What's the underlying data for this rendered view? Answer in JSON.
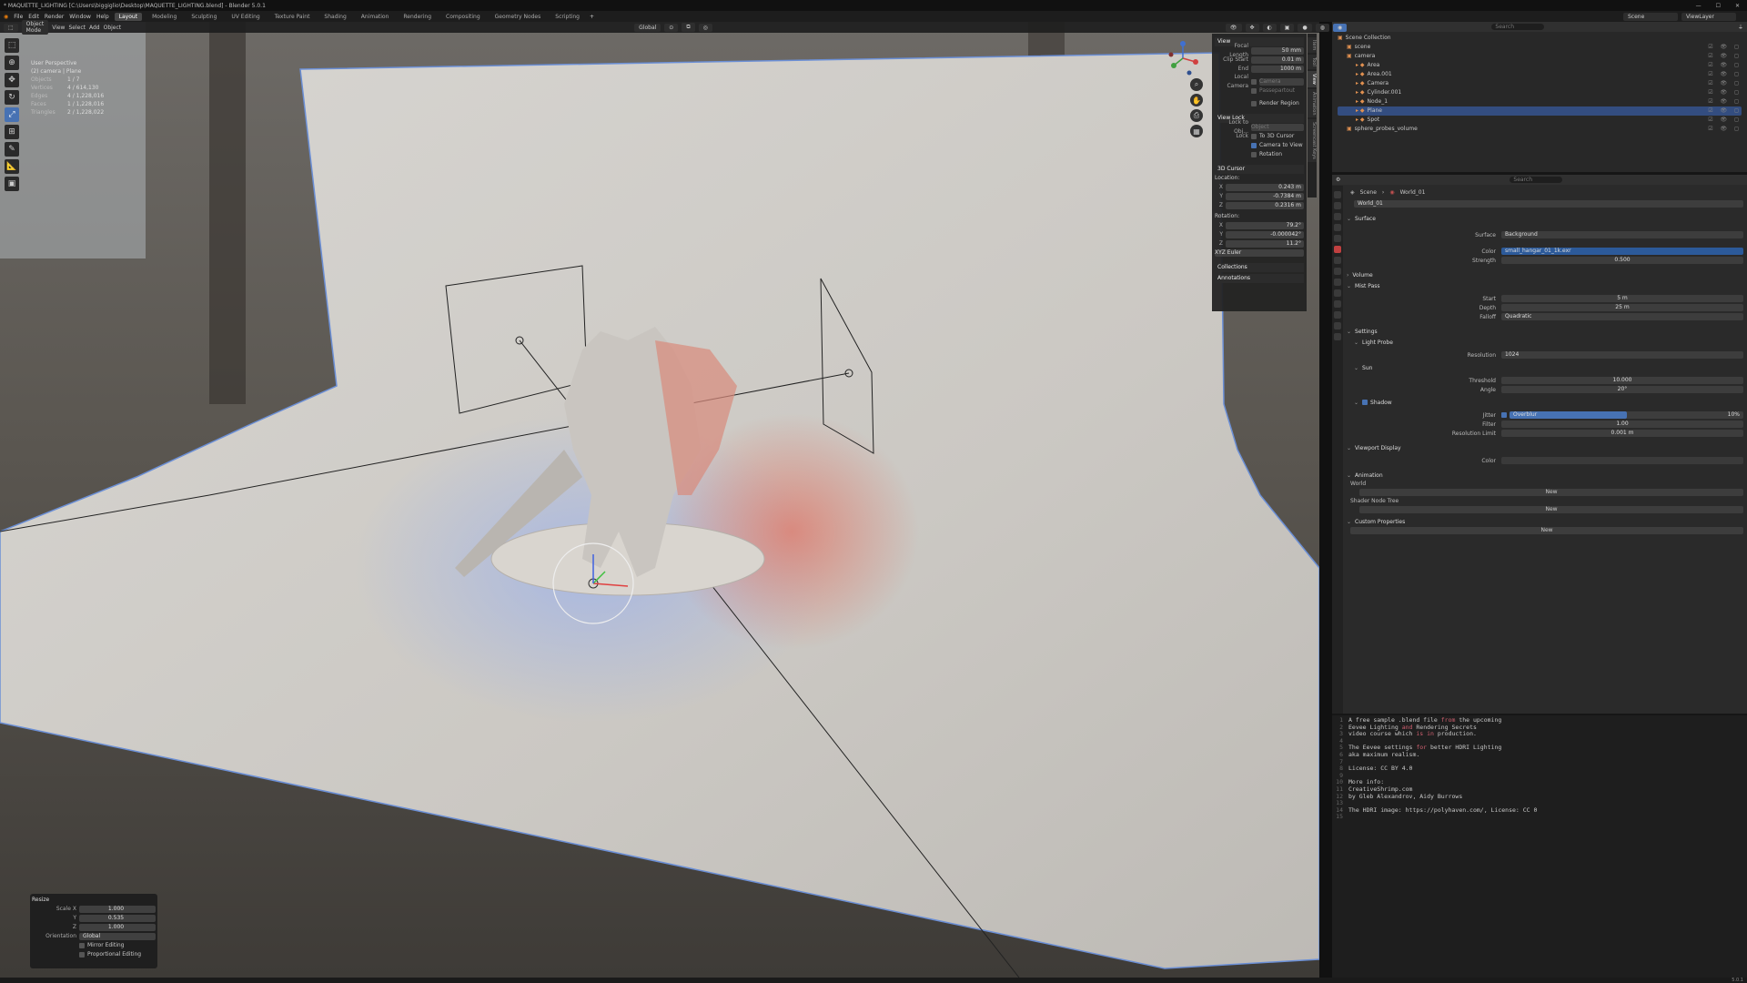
{
  "window": {
    "title": "* MAQUETTE_LIGHTING [C:\\Users\\biggiglio\\Desktop\\MAQUETTE_LIGHTING.blend] - Blender 5.0.1",
    "controls": [
      "—",
      "☐",
      "✕"
    ]
  },
  "menu": [
    "File",
    "Edit",
    "Render",
    "Window",
    "Help"
  ],
  "workspaces": [
    "Layout",
    "Modeling",
    "Sculpting",
    "UV Editing",
    "Texture Paint",
    "Shading",
    "Animation",
    "Rendering",
    "Compositing",
    "Geometry Nodes",
    "Scripting"
  ],
  "active_workspace": "Layout",
  "scene_selector": {
    "scene": "Scene",
    "view_layer": "ViewLayer"
  },
  "viewport": {
    "header": {
      "mode": "Object Mode",
      "menus": [
        "View",
        "Select",
        "Add",
        "Object"
      ],
      "orientation": "Global"
    },
    "overlay_title": "User Perspective",
    "overlay_sub": "(2) camera | Plane",
    "stats": [
      {
        "k": "Objects",
        "v": "1 / 7"
      },
      {
        "k": "Vertices",
        "v": "4 / 614,130"
      },
      {
        "k": "Edges",
        "v": "4 / 1,228,016"
      },
      {
        "k": "Faces",
        "v": "1 / 1,228,016"
      },
      {
        "k": "Triangles",
        "v": "2 / 1,228,022"
      }
    ],
    "gizmo_axes": [
      "X",
      "Y",
      "Z"
    ]
  },
  "npanel": {
    "view_title": "View",
    "focal_label": "Focal Length",
    "focal": "50 mm",
    "clip_start_label": "Clip Start",
    "clip_start": "0.01 m",
    "clip_end_label": "End",
    "clip_end": "1000 m",
    "local_camera_label": "Local Camera",
    "local_camera": "Camera",
    "passepartout": "Passepartout",
    "render_region": "Render Region",
    "view_lock_title": "View Lock",
    "lock_obj_label": "Lock to Obj...",
    "lock_obj": "Object",
    "lock_label": "Lock",
    "to_cursor": "To 3D Cursor",
    "camera_to_view": "Camera to View",
    "rotation": "Rotation",
    "cursor_title": "3D Cursor",
    "location_label": "Location:",
    "loc": {
      "x": "0.243 m",
      "y": "-0.7384 m",
      "z": "0.2316 m"
    },
    "rotation_label": "Rotation:",
    "rot": {
      "x": "79.2°",
      "y": "-0.000042°",
      "z": "11.2°"
    },
    "euler": "XYZ Euler",
    "collections": "Collections",
    "annotations": "Annotations",
    "tabs": [
      "Item",
      "Tool",
      "View",
      "Animation",
      "Screencast Keys"
    ]
  },
  "redo": {
    "title": "Resize",
    "scale_label": "Scale X",
    "sx": "1.000",
    "sy": "0.535",
    "sz": "1.000",
    "y_label": "Y",
    "z_label": "Z",
    "orientation_label": "Orientation",
    "orientation": "Global",
    "mirror": "Mirror Editing",
    "proportional": "Proportional Editing"
  },
  "outliner": {
    "search_placeholder": "Search",
    "items": [
      {
        "name": "Scene Collection",
        "depth": 0,
        "sel": false
      },
      {
        "name": "scene",
        "depth": 1,
        "sel": false
      },
      {
        "name": "camera",
        "depth": 1,
        "sel": false
      },
      {
        "name": "Area",
        "depth": 2,
        "sel": false
      },
      {
        "name": "Area.001",
        "depth": 2,
        "sel": false
      },
      {
        "name": "Camera",
        "depth": 2,
        "sel": false
      },
      {
        "name": "Cylinder.001",
        "depth": 2,
        "sel": false
      },
      {
        "name": "Node_1",
        "depth": 2,
        "sel": false
      },
      {
        "name": "Plane",
        "depth": 2,
        "sel": true
      },
      {
        "name": "Spot",
        "depth": 2,
        "sel": false
      },
      {
        "name": "sphere_probes_volume",
        "depth": 1,
        "sel": false
      }
    ]
  },
  "properties": {
    "search_placeholder": "Search",
    "breadcrumb": [
      "Scene",
      "›",
      "World_01"
    ],
    "world_name": "World_01",
    "surface": "Surface",
    "surface_label": "Surface",
    "surface_val": "Background",
    "color_label": "Color",
    "color_val": "small_hangar_01_1k.exr",
    "strength_label": "Strength",
    "strength_val": "0.500",
    "volume": "Volume",
    "mist": "Mist Pass",
    "start_label": "Start",
    "start_val": "5 m",
    "depth_label": "Depth",
    "depth_val": "25 m",
    "falloff_label": "Falloff",
    "falloff_val": "Quadratic",
    "settings": "Settings",
    "light_probe": "Light Probe",
    "resolution_label": "Resolution",
    "resolution_val": "1024",
    "sun": "Sun",
    "threshold_label": "Threshold",
    "threshold_val": "10.000",
    "angle_label": "Angle",
    "angle_val": "20°",
    "shadow": "Shadow",
    "jitter_label": "Jitter",
    "jitter_val": "Overblur",
    "jitter_pct": "10%",
    "filter_label": "Filter",
    "filter_val": "1.00",
    "reslimit_label": "Resolution Limit",
    "reslimit_val": "0.001 m",
    "viewport_display": "Viewport Display",
    "vcolor_label": "Color",
    "animation": "Animation",
    "world_label": "World",
    "new1": "New",
    "shader_tree_label": "Shader Node Tree",
    "new2": "New",
    "custom_props": "Custom Properties",
    "new3": "New"
  },
  "text_editor": {
    "lines": [
      [
        "1",
        "A free sample .blend file ",
        {
          "kw": "from"
        },
        " the upcoming"
      ],
      [
        "2",
        "Eevee Lighting ",
        {
          "kw": "and"
        },
        " Rendering Secrets"
      ],
      [
        "3",
        "video course which ",
        {
          "kw": "is"
        },
        " ",
        {
          "kw": "in"
        },
        " production."
      ],
      [
        "4",
        ""
      ],
      [
        "5",
        "The Eevee settings ",
        {
          "kw": "for"
        },
        " better HDRI Lighting"
      ],
      [
        "6",
        "aka maximum realism."
      ],
      [
        "7",
        ""
      ],
      [
        "8",
        "License: CC BY 4.0"
      ],
      [
        "9",
        ""
      ],
      [
        "10",
        "More info:"
      ],
      [
        "11",
        "CreativeShrimp.com"
      ],
      [
        "12",
        "by Gleb Alexandrov, Aidy Burrows"
      ],
      [
        "13",
        ""
      ],
      [
        "14",
        "The HDRI image: https://polyhaven.com/, License: CC 0"
      ],
      [
        "15",
        ""
      ]
    ]
  },
  "status_version": "5.0.1",
  "colors": {
    "accent": "#4772b3",
    "selected_row": "#334d80",
    "background": "#161616"
  }
}
